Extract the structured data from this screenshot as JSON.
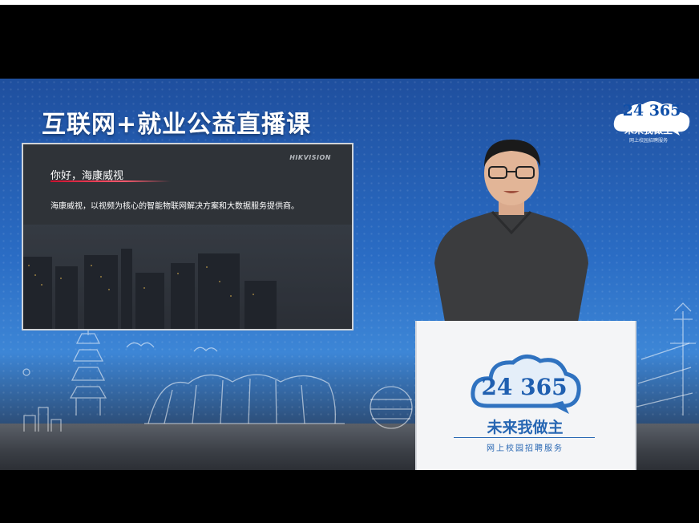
{
  "banner": {
    "title": "互联网+就业公益直播课"
  },
  "corner_logo": {
    "number": "24 365",
    "slogan": "未来我做主",
    "subtitle": "网上校园招聘服务"
  },
  "slide": {
    "greeting": "你好，海康威视",
    "brand": "HIKVISION",
    "description": "海康威视，以视频为核心的智能物联网解决方案和大数据服务提供商。"
  },
  "podium_logo": {
    "number": "24 365",
    "slogan": "未来我做主",
    "subtitle": "网上校园招聘服务"
  },
  "colors": {
    "brand_blue": "#2867b3",
    "hikvision_red": "#c8102e",
    "studio_blue": "#2a6cc4"
  }
}
